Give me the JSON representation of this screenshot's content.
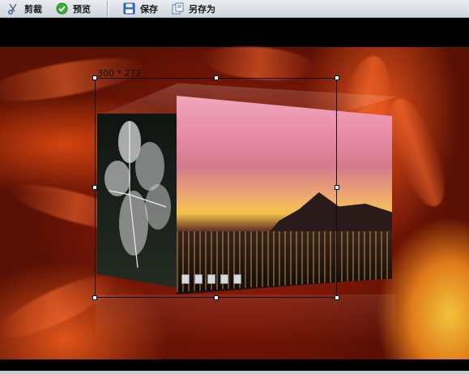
{
  "toolbar": {
    "crop_label": "剪裁",
    "preview_label": "预览",
    "save_label": "保存",
    "save_as_label": "另存为"
  },
  "selection": {
    "size_text": "300 * 272"
  },
  "colors": {
    "toolbar_bg": "#dde3e8",
    "selection_border": "#111111",
    "handle_fill": "#ffffff"
  },
  "icons": {
    "crop": "scissors-icon",
    "preview": "checkmark-icon",
    "save": "floppy-disk-icon",
    "save_as": "save-as-icon"
  }
}
